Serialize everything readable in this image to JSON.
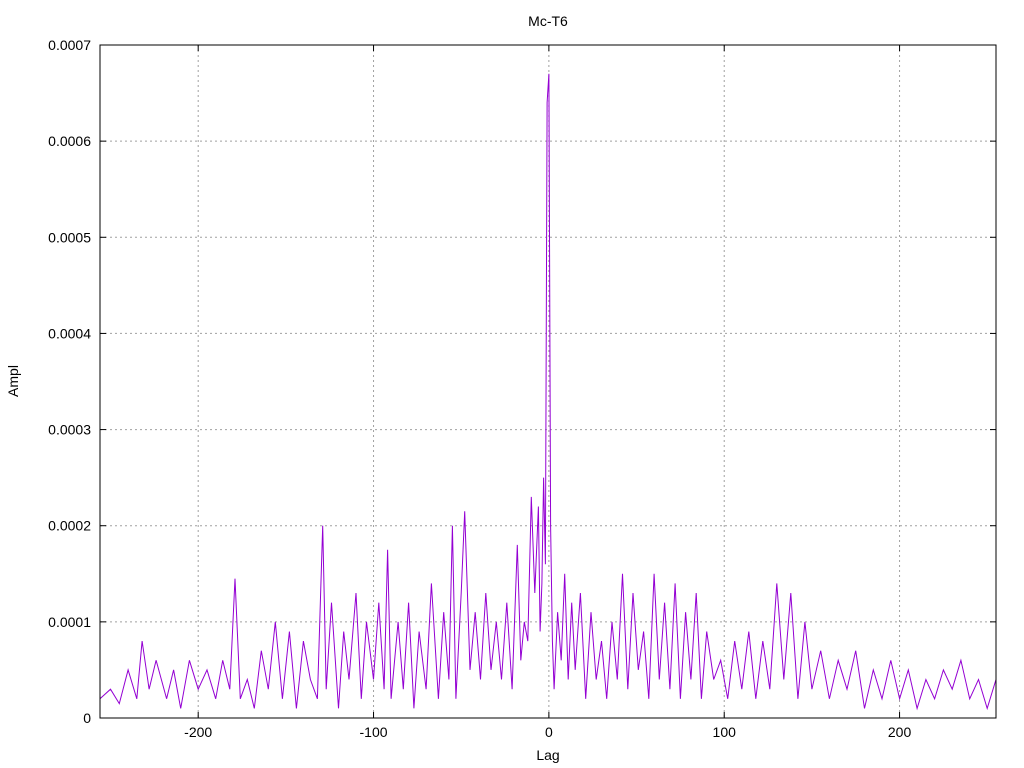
{
  "chart_data": {
    "type": "line",
    "title": "Mc-T6",
    "xlabel": "Lag",
    "ylabel": "Ampl",
    "xlim": [
      -256,
      255
    ],
    "ylim": [
      0,
      0.0007
    ],
    "grid": true,
    "x_ticks": [
      -200,
      -100,
      0,
      100,
      200
    ],
    "y_ticks": [
      0,
      0.0001,
      0.0002,
      0.0003,
      0.0004,
      0.0005,
      0.0006,
      0.0007
    ],
    "x_tick_labels": [
      "-200",
      "-100",
      "0",
      "100",
      "200"
    ],
    "y_tick_labels": [
      "0",
      "0.0001",
      "0.0002",
      "0.0003",
      "0.0004",
      "0.0005",
      "0.0006",
      "0.0007"
    ],
    "series": [
      {
        "color": "#9400d3",
        "x": [
          -256,
          -250,
          -245,
          -240,
          -235,
          -232,
          -228,
          -224,
          -218,
          -214,
          -210,
          -205,
          -200,
          -195,
          -190,
          -186,
          -182,
          -179,
          -176,
          -172,
          -168,
          -164,
          -160,
          -156,
          -152,
          -148,
          -144,
          -140,
          -136,
          -132,
          -129,
          -127,
          -124,
          -120,
          -117,
          -114,
          -110,
          -107,
          -104,
          -100,
          -97,
          -94,
          -92,
          -90,
          -86,
          -83,
          -80,
          -77,
          -74,
          -70,
          -67,
          -63,
          -60,
          -57,
          -55,
          -53,
          -50,
          -48,
          -45,
          -42,
          -39,
          -36,
          -33,
          -30,
          -27,
          -24,
          -21,
          -18,
          -16,
          -14,
          -12,
          -10,
          -8,
          -6,
          -5,
          -4,
          -3,
          -2,
          -1,
          0,
          1,
          2,
          3,
          5,
          7,
          9,
          11,
          13,
          15,
          18,
          21,
          24,
          27,
          30,
          33,
          36,
          39,
          42,
          45,
          48,
          51,
          54,
          57,
          60,
          63,
          66,
          69,
          72,
          75,
          78,
          81,
          84,
          87,
          90,
          94,
          98,
          102,
          106,
          110,
          114,
          118,
          122,
          126,
          130,
          134,
          138,
          142,
          146,
          150,
          155,
          160,
          165,
          170,
          175,
          180,
          185,
          190,
          195,
          200,
          205,
          210,
          215,
          220,
          225,
          230,
          235,
          240,
          245,
          250,
          255
        ],
        "y": [
          2e-05,
          3e-05,
          1.5e-05,
          5e-05,
          2e-05,
          8e-05,
          3e-05,
          6e-05,
          2e-05,
          5e-05,
          1e-05,
          6e-05,
          3e-05,
          5e-05,
          2e-05,
          6e-05,
          3e-05,
          0.000145,
          2e-05,
          4e-05,
          1e-05,
          7e-05,
          3e-05,
          0.0001,
          2e-05,
          9e-05,
          1e-05,
          8e-05,
          4e-05,
          2e-05,
          0.0002,
          3e-05,
          0.00012,
          1e-05,
          9e-05,
          4e-05,
          0.00013,
          2e-05,
          0.0001,
          4e-05,
          0.00012,
          3e-05,
          0.000175,
          2e-05,
          0.0001,
          3e-05,
          0.00012,
          1e-05,
          9e-05,
          3e-05,
          0.00014,
          2e-05,
          0.00011,
          4e-05,
          0.0002,
          2e-05,
          0.00013,
          0.000215,
          5e-05,
          0.00011,
          4e-05,
          0.00013,
          5e-05,
          0.0001,
          4e-05,
          0.00012,
          3e-05,
          0.00018,
          6e-05,
          0.0001,
          8e-05,
          0.00023,
          0.00013,
          0.00022,
          9e-05,
          0.00014,
          0.00025,
          0.00016,
          0.00064,
          0.00067,
          0.0002,
          8e-05,
          3e-05,
          0.00011,
          6e-05,
          0.00015,
          4e-05,
          0.00012,
          5e-05,
          0.00013,
          2e-05,
          0.00011,
          4e-05,
          8e-05,
          2e-05,
          0.0001,
          4e-05,
          0.00015,
          3e-05,
          0.00013,
          5e-05,
          9e-05,
          2e-05,
          0.00015,
          4e-05,
          0.00012,
          3e-05,
          0.00014,
          2e-05,
          0.00011,
          4e-05,
          0.00013,
          2e-05,
          9e-05,
          4e-05,
          6e-05,
          2e-05,
          8e-05,
          3e-05,
          9e-05,
          2e-05,
          8e-05,
          3e-05,
          0.00014,
          4e-05,
          0.00013,
          2e-05,
          0.0001,
          3e-05,
          7e-05,
          2e-05,
          6e-05,
          3e-05,
          7e-05,
          1e-05,
          5e-05,
          2e-05,
          6e-05,
          2e-05,
          5e-05,
          1e-05,
          4e-05,
          2e-05,
          5e-05,
          3e-05,
          6e-05,
          2e-05,
          4e-05,
          1e-05,
          4e-05
        ]
      }
    ]
  }
}
